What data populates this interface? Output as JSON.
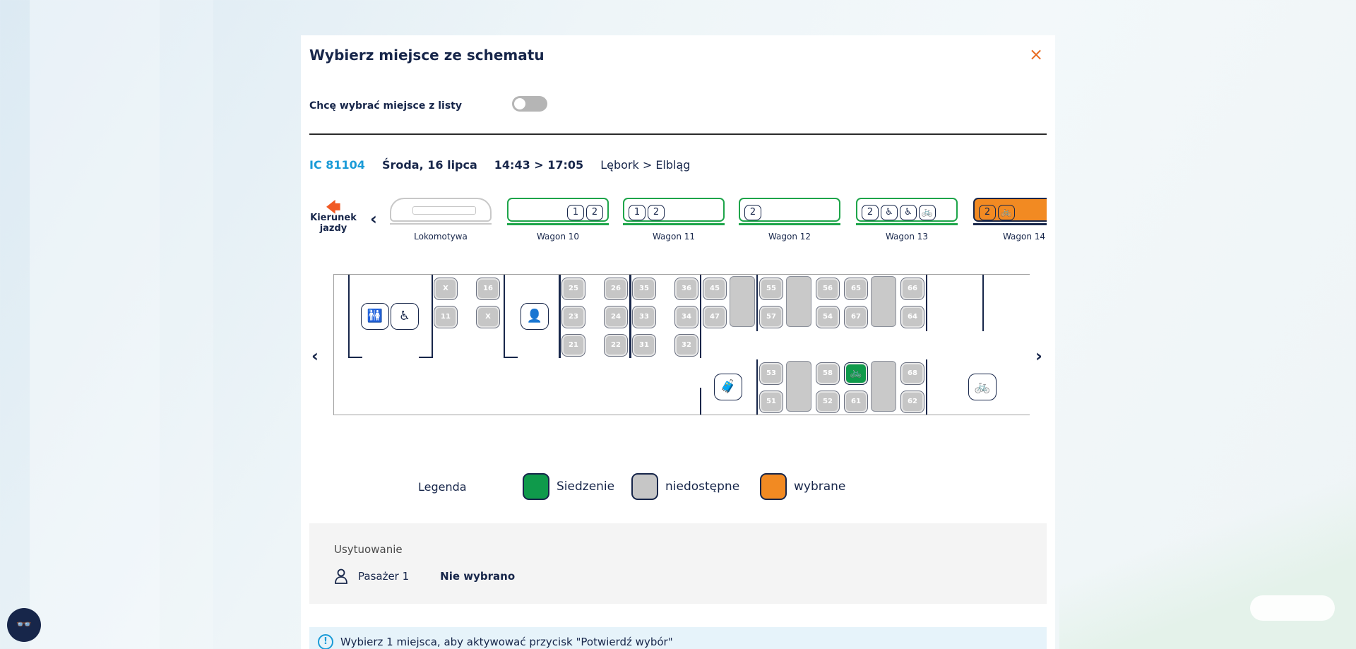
{
  "modal": {
    "title": "Wybierz miejsce ze schematu",
    "close_label": "×",
    "toggle_label": "Chcę wybrać miejsce z listy"
  },
  "trip": {
    "number": "IC 81104",
    "date": "Środa, 16 lipca",
    "time": "14:43 > 17:05",
    "route": "Lębork > Elbląg"
  },
  "direction": {
    "line1": "Kierunek",
    "line2": "jazdy",
    "arrow": "🡄",
    "prev": "‹"
  },
  "wagons": [
    {
      "label": "Lokomotywa",
      "type": "loco",
      "icons": []
    },
    {
      "label": "Wagon 10",
      "type": "normal",
      "icons": [
        "1",
        "2"
      ]
    },
    {
      "label": "Wagon 11",
      "type": "normal",
      "icons": [
        "1",
        "2"
      ]
    },
    {
      "label": "Wagon 12",
      "type": "normal",
      "icons": [
        "2"
      ]
    },
    {
      "label": "Wagon 13",
      "type": "normal",
      "icons": [
        "2",
        "♿",
        "♿",
        "🚲"
      ]
    },
    {
      "label": "Wagon 14",
      "type": "selected",
      "icons": [
        "2",
        "🚲"
      ]
    }
  ],
  "map": {
    "prev": "‹",
    "next": "›",
    "seats": [
      {
        "n": "X"
      },
      {
        "n": "16"
      },
      {
        "n": "11"
      },
      {
        "n": "X"
      },
      {
        "n": "25"
      },
      {
        "n": "26"
      },
      {
        "n": "35"
      },
      {
        "n": "36"
      },
      {
        "n": "45"
      },
      {
        "n": "23"
      },
      {
        "n": "24"
      },
      {
        "n": "33"
      },
      {
        "n": "34"
      },
      {
        "n": "47"
      },
      {
        "n": "21"
      },
      {
        "n": "22"
      },
      {
        "n": "31"
      },
      {
        "n": "32"
      },
      {
        "n": "55"
      },
      {
        "n": "56"
      },
      {
        "n": "65"
      },
      {
        "n": "66"
      },
      {
        "n": "57"
      },
      {
        "n": "54"
      },
      {
        "n": "67"
      },
      {
        "n": "64"
      },
      {
        "n": "53"
      },
      {
        "n": "58"
      },
      {
        "n": "68"
      },
      {
        "n": "51"
      },
      {
        "n": "52"
      },
      {
        "n": "61"
      },
      {
        "n": "62"
      },
      {
        "n": "🚲"
      }
    ],
    "icons": {
      "wc": "🚻",
      "wheelchair": "♿",
      "conductor": "👤",
      "luggage": "🧳",
      "bicycle": "🚲"
    }
  },
  "legend": {
    "title": "Legenda",
    "items": [
      {
        "label": "Siedzenie",
        "color": "#0f9a4b"
      },
      {
        "label": "niedostępne",
        "color": "#c6c6c6"
      },
      {
        "label": "wybrane",
        "color": "#f28a22"
      }
    ]
  },
  "placement": {
    "title": "Usytuowanie",
    "passenger_label": "Pasażer 1",
    "passenger_value": "Nie wybrano"
  },
  "info": {
    "icon": "!",
    "text": "Wybierz 1 miejsca, aby aktywować przycisk \"Potwierdź wybór\""
  },
  "a11y_button": "👓"
}
